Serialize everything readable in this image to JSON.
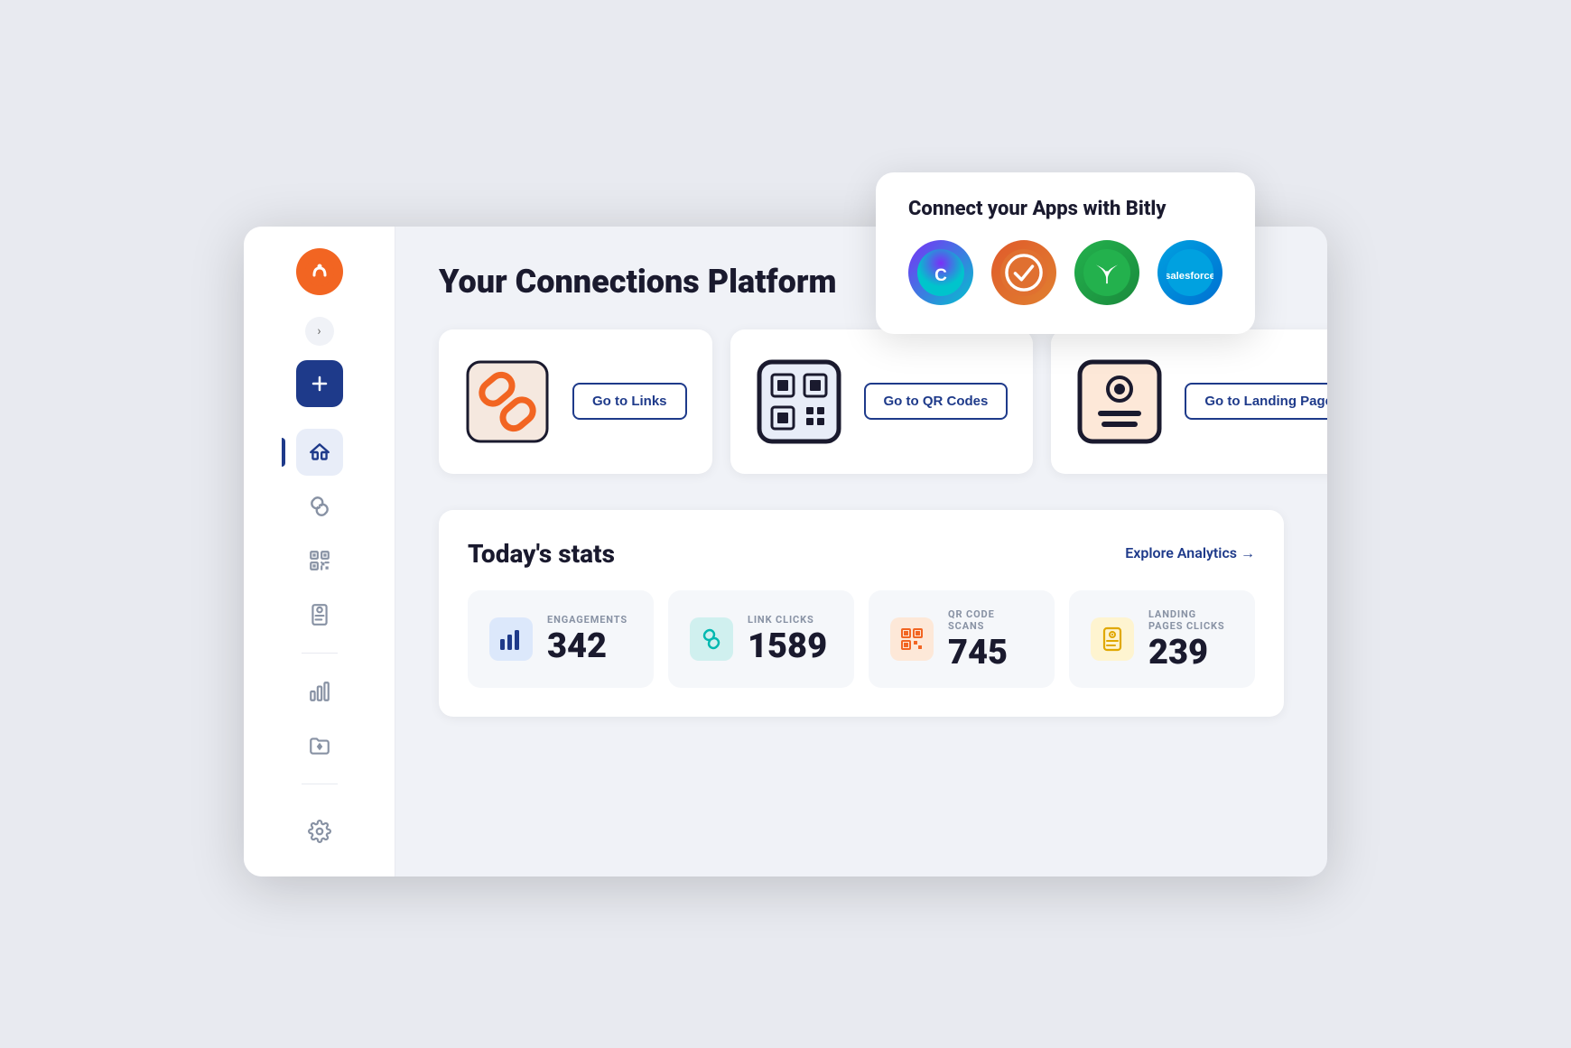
{
  "tooltip": {
    "title": "Connect your Apps with Bitly",
    "apps": [
      {
        "name": "Canva",
        "class": "app-canva",
        "label": "C"
      },
      {
        "name": "Check",
        "class": "app-check",
        "label": "✓"
      },
      {
        "name": "Sprout",
        "class": "app-sprout",
        "label": "🌿"
      },
      {
        "name": "Salesforce",
        "class": "app-salesforce",
        "label": "sf"
      }
    ]
  },
  "sidebar": {
    "logo_alt": "Bitly logo",
    "create_label": "+",
    "nav_items": [
      {
        "name": "home",
        "label": "Home",
        "active": true
      },
      {
        "name": "links",
        "label": "Links",
        "active": false
      },
      {
        "name": "qr-codes",
        "label": "QR Codes",
        "active": false
      },
      {
        "name": "landing-pages",
        "label": "Landing Pages",
        "active": false
      },
      {
        "name": "analytics",
        "label": "Analytics",
        "active": false
      },
      {
        "name": "campaigns",
        "label": "Campaigns",
        "active": false
      }
    ],
    "settings_label": "Settings"
  },
  "main": {
    "page_title": "Your Connections Platform",
    "feature_cards": [
      {
        "id": "links",
        "button_label": "Go to Links"
      },
      {
        "id": "qr-codes",
        "button_label": "Go to QR Codes"
      },
      {
        "id": "landing-pages",
        "button_label": "Go to Landing Pages"
      }
    ],
    "stats": {
      "title": "Today's stats",
      "explore_label": "Explore Analytics →",
      "items": [
        {
          "id": "engagements",
          "label": "ENGAGEMENTS",
          "value": "342",
          "icon_type": "bar"
        },
        {
          "id": "link-clicks",
          "label": "LINK CLICKS",
          "value": "1589",
          "icon_type": "link"
        },
        {
          "id": "qr-scans",
          "label": "QR CODE SCANS",
          "value": "745",
          "icon_type": "qr"
        },
        {
          "id": "lp-clicks",
          "label": "LANDING PAGES CLICKS",
          "value": "239",
          "icon_type": "page"
        }
      ]
    }
  }
}
